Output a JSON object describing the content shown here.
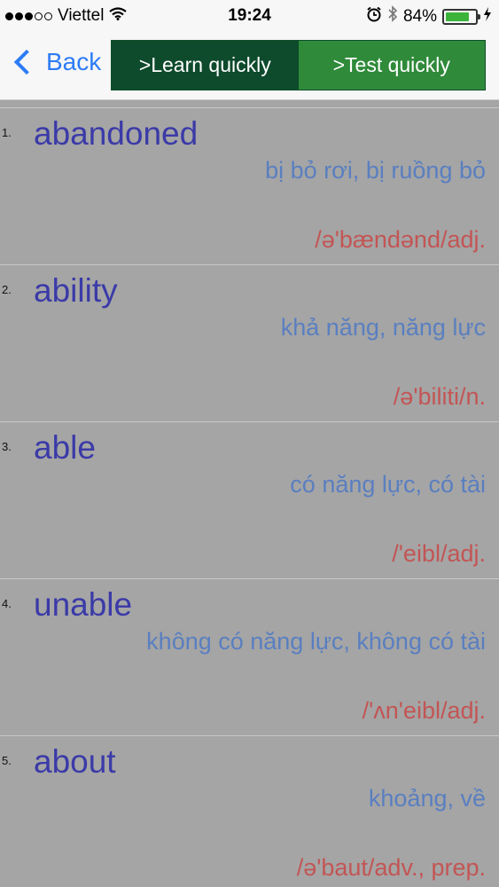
{
  "status_bar": {
    "carrier": "Viettel",
    "time": "19:24",
    "battery": "84%",
    "battery_level": 0.84,
    "icons": [
      "signal-dots-icon",
      "wifi-icon",
      "alarm-icon",
      "bluetooth-icon",
      "battery-icon",
      "charging-bolt-icon"
    ]
  },
  "nav": {
    "back_label": "Back",
    "learn_label": ">Learn quickly",
    "test_label": ">Test quickly"
  },
  "colors": {
    "background": "#a5a5a5",
    "word": "#3b3aa8",
    "meaning": "#5a7fc0",
    "phonetic": "#c35555",
    "learn_btn": "#0e4a2c",
    "test_btn": "#2f8a3a",
    "back": "#2d7cf6"
  },
  "words": [
    {
      "num": "1.",
      "word": "abandoned",
      "meaning": "bị bỏ rơi, bị ruồng bỏ",
      "phonetic": "/ə'bændənd/adj."
    },
    {
      "num": "2.",
      "word": "ability",
      "meaning": "khả năng, năng lực",
      "phonetic": "/ə'biliti/n."
    },
    {
      "num": "3.",
      "word": "able",
      "meaning": "có năng lực, có tài",
      "phonetic": "/'eibl/adj."
    },
    {
      "num": "4.",
      "word": "unable",
      "meaning": "không có năng lực, không có tài",
      "phonetic": "/'ʌn'eibl/adj."
    },
    {
      "num": "5.",
      "word": "about",
      "meaning": "khoảng, về",
      "phonetic": "/ə'baut/adv., prep."
    }
  ]
}
